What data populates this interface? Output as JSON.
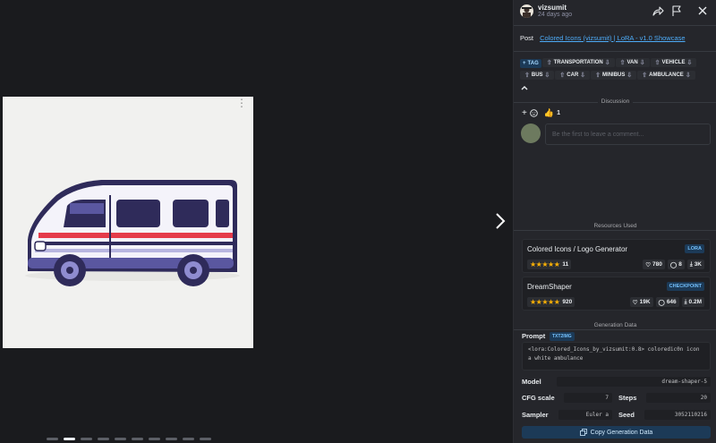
{
  "header": {
    "username": "vizsumit",
    "time": "24 days ago"
  },
  "post": {
    "label": "Post",
    "link": "Colored Icons (vizsumit) | LoRA - v1.0 Showcase"
  },
  "tags": [
    {
      "label": "TAG",
      "add": true
    },
    {
      "label": "TRANSPORTATION"
    },
    {
      "label": "VAN"
    },
    {
      "label": "VEHICLE"
    },
    {
      "label": "BUS"
    },
    {
      "label": "CAR"
    },
    {
      "label": "MINIBUS"
    },
    {
      "label": "AMBULANCE"
    }
  ],
  "discussion": {
    "title": "Discussion",
    "reaction_count": "1",
    "comment_placeholder": "Be the first to leave a comment..."
  },
  "resources": {
    "title": "Resources Used",
    "items": [
      {
        "name": "Colored Icons / Logo Generator",
        "type": "LORA",
        "rating_count": "11",
        "likes": "780",
        "comments": "8",
        "downloads": "3K"
      },
      {
        "name": "DreamShaper",
        "type": "CHECKPOINT",
        "rating_count": "920",
        "likes": "19K",
        "comments": "646",
        "downloads": "0.2M"
      }
    ]
  },
  "generation": {
    "title": "Generation Data",
    "prompt_label": "Prompt",
    "prompt_badge": "TXT2IMG",
    "prompt_text": "<lora:Colored_Icons_by_vizsumit:0.8> coloredic0n icon a white ambulance",
    "model_label": "Model",
    "model_value": "dream-shaper-5",
    "cfg_label": "CFG scale",
    "cfg_value": "7",
    "steps_label": "Steps",
    "steps_value": "20",
    "sampler_label": "Sampler",
    "sampler_value": "Euler a",
    "seed_label": "Seed",
    "seed_value": "3052110216",
    "copy_label": "Copy Generation Data"
  },
  "colors": {
    "accent": "#4dabf7",
    "badge_bg": "#1c3a57",
    "star": "#fab005"
  }
}
